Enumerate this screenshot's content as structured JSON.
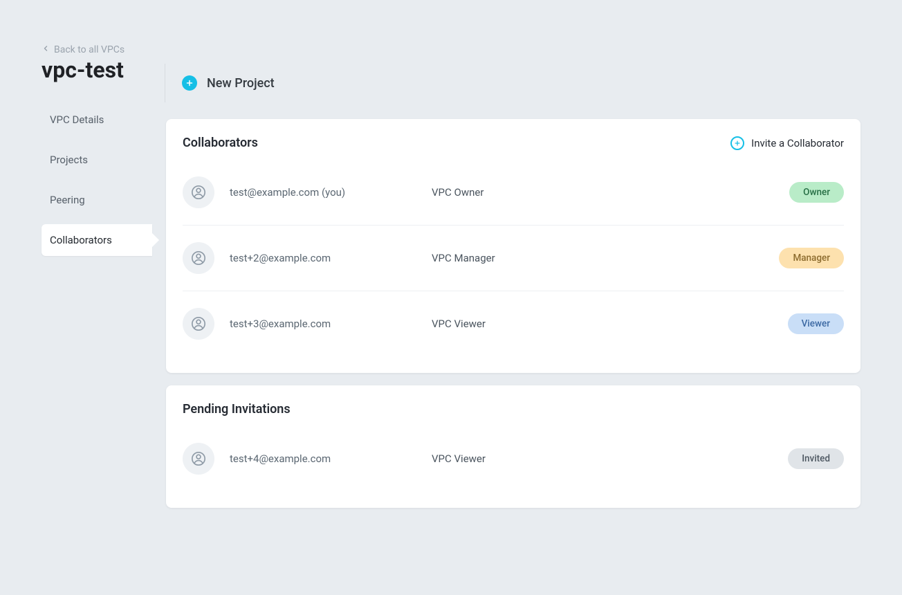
{
  "back_label": "Back to all VPCs",
  "vpc_name": "vpc-test",
  "sidebar": {
    "items": [
      {
        "label": "VPC Details",
        "active": false
      },
      {
        "label": "Projects",
        "active": false
      },
      {
        "label": "Peering",
        "active": false
      },
      {
        "label": "Collaborators",
        "active": true
      }
    ]
  },
  "header": {
    "new_project_label": "New Project"
  },
  "collaborators_card": {
    "title": "Collaborators",
    "invite_label": "Invite a Collaborator",
    "rows": [
      {
        "email": "test@example.com (you)",
        "role": "VPC Owner",
        "badge": "Owner",
        "badge_class": "badge-owner"
      },
      {
        "email": "test+2@example.com",
        "role": "VPC Manager",
        "badge": "Manager",
        "badge_class": "badge-manager"
      },
      {
        "email": "test+3@example.com",
        "role": "VPC Viewer",
        "badge": "Viewer",
        "badge_class": "badge-viewer"
      }
    ]
  },
  "pending_card": {
    "title": "Pending Invitations",
    "rows": [
      {
        "email": "test+4@example.com",
        "role": "VPC Viewer",
        "badge": "Invited",
        "badge_class": "badge-invited"
      }
    ]
  },
  "colors": {
    "accent": "#16bfe6",
    "bg": "#e8ecf0",
    "card_bg": "#ffffff"
  }
}
